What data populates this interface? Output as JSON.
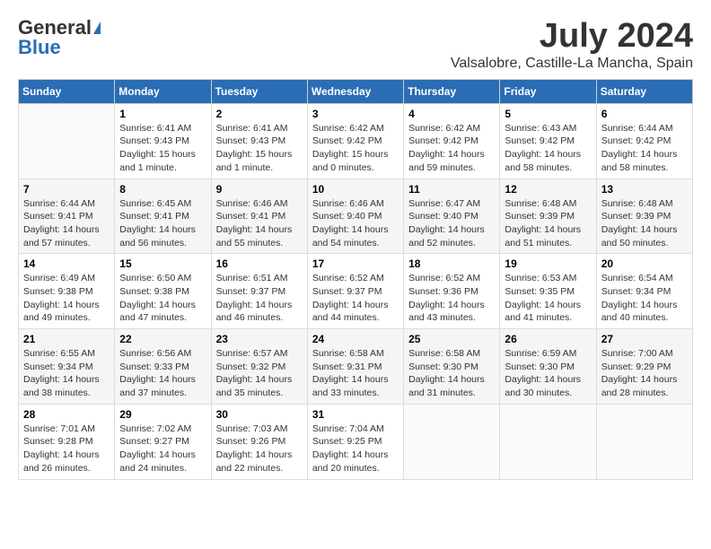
{
  "header": {
    "logo_general": "General",
    "logo_blue": "Blue",
    "month_title": "July 2024",
    "location": "Valsalobre, Castille-La Mancha, Spain"
  },
  "days_of_week": [
    "Sunday",
    "Monday",
    "Tuesday",
    "Wednesday",
    "Thursday",
    "Friday",
    "Saturday"
  ],
  "weeks": [
    [
      {
        "day": "",
        "sunrise": "",
        "sunset": "",
        "daylight": ""
      },
      {
        "day": "1",
        "sunrise": "Sunrise: 6:41 AM",
        "sunset": "Sunset: 9:43 PM",
        "daylight": "Daylight: 15 hours and 1 minute."
      },
      {
        "day": "2",
        "sunrise": "Sunrise: 6:41 AM",
        "sunset": "Sunset: 9:43 PM",
        "daylight": "Daylight: 15 hours and 1 minute."
      },
      {
        "day": "3",
        "sunrise": "Sunrise: 6:42 AM",
        "sunset": "Sunset: 9:42 PM",
        "daylight": "Daylight: 15 hours and 0 minutes."
      },
      {
        "day": "4",
        "sunrise": "Sunrise: 6:42 AM",
        "sunset": "Sunset: 9:42 PM",
        "daylight": "Daylight: 14 hours and 59 minutes."
      },
      {
        "day": "5",
        "sunrise": "Sunrise: 6:43 AM",
        "sunset": "Sunset: 9:42 PM",
        "daylight": "Daylight: 14 hours and 58 minutes."
      },
      {
        "day": "6",
        "sunrise": "Sunrise: 6:44 AM",
        "sunset": "Sunset: 9:42 PM",
        "daylight": "Daylight: 14 hours and 58 minutes."
      }
    ],
    [
      {
        "day": "7",
        "sunrise": "Sunrise: 6:44 AM",
        "sunset": "Sunset: 9:41 PM",
        "daylight": "Daylight: 14 hours and 57 minutes."
      },
      {
        "day": "8",
        "sunrise": "Sunrise: 6:45 AM",
        "sunset": "Sunset: 9:41 PM",
        "daylight": "Daylight: 14 hours and 56 minutes."
      },
      {
        "day": "9",
        "sunrise": "Sunrise: 6:46 AM",
        "sunset": "Sunset: 9:41 PM",
        "daylight": "Daylight: 14 hours and 55 minutes."
      },
      {
        "day": "10",
        "sunrise": "Sunrise: 6:46 AM",
        "sunset": "Sunset: 9:40 PM",
        "daylight": "Daylight: 14 hours and 54 minutes."
      },
      {
        "day": "11",
        "sunrise": "Sunrise: 6:47 AM",
        "sunset": "Sunset: 9:40 PM",
        "daylight": "Daylight: 14 hours and 52 minutes."
      },
      {
        "day": "12",
        "sunrise": "Sunrise: 6:48 AM",
        "sunset": "Sunset: 9:39 PM",
        "daylight": "Daylight: 14 hours and 51 minutes."
      },
      {
        "day": "13",
        "sunrise": "Sunrise: 6:48 AM",
        "sunset": "Sunset: 9:39 PM",
        "daylight": "Daylight: 14 hours and 50 minutes."
      }
    ],
    [
      {
        "day": "14",
        "sunrise": "Sunrise: 6:49 AM",
        "sunset": "Sunset: 9:38 PM",
        "daylight": "Daylight: 14 hours and 49 minutes."
      },
      {
        "day": "15",
        "sunrise": "Sunrise: 6:50 AM",
        "sunset": "Sunset: 9:38 PM",
        "daylight": "Daylight: 14 hours and 47 minutes."
      },
      {
        "day": "16",
        "sunrise": "Sunrise: 6:51 AM",
        "sunset": "Sunset: 9:37 PM",
        "daylight": "Daylight: 14 hours and 46 minutes."
      },
      {
        "day": "17",
        "sunrise": "Sunrise: 6:52 AM",
        "sunset": "Sunset: 9:37 PM",
        "daylight": "Daylight: 14 hours and 44 minutes."
      },
      {
        "day": "18",
        "sunrise": "Sunrise: 6:52 AM",
        "sunset": "Sunset: 9:36 PM",
        "daylight": "Daylight: 14 hours and 43 minutes."
      },
      {
        "day": "19",
        "sunrise": "Sunrise: 6:53 AM",
        "sunset": "Sunset: 9:35 PM",
        "daylight": "Daylight: 14 hours and 41 minutes."
      },
      {
        "day": "20",
        "sunrise": "Sunrise: 6:54 AM",
        "sunset": "Sunset: 9:34 PM",
        "daylight": "Daylight: 14 hours and 40 minutes."
      }
    ],
    [
      {
        "day": "21",
        "sunrise": "Sunrise: 6:55 AM",
        "sunset": "Sunset: 9:34 PM",
        "daylight": "Daylight: 14 hours and 38 minutes."
      },
      {
        "day": "22",
        "sunrise": "Sunrise: 6:56 AM",
        "sunset": "Sunset: 9:33 PM",
        "daylight": "Daylight: 14 hours and 37 minutes."
      },
      {
        "day": "23",
        "sunrise": "Sunrise: 6:57 AM",
        "sunset": "Sunset: 9:32 PM",
        "daylight": "Daylight: 14 hours and 35 minutes."
      },
      {
        "day": "24",
        "sunrise": "Sunrise: 6:58 AM",
        "sunset": "Sunset: 9:31 PM",
        "daylight": "Daylight: 14 hours and 33 minutes."
      },
      {
        "day": "25",
        "sunrise": "Sunrise: 6:58 AM",
        "sunset": "Sunset: 9:30 PM",
        "daylight": "Daylight: 14 hours and 31 minutes."
      },
      {
        "day": "26",
        "sunrise": "Sunrise: 6:59 AM",
        "sunset": "Sunset: 9:30 PM",
        "daylight": "Daylight: 14 hours and 30 minutes."
      },
      {
        "day": "27",
        "sunrise": "Sunrise: 7:00 AM",
        "sunset": "Sunset: 9:29 PM",
        "daylight": "Daylight: 14 hours and 28 minutes."
      }
    ],
    [
      {
        "day": "28",
        "sunrise": "Sunrise: 7:01 AM",
        "sunset": "Sunset: 9:28 PM",
        "daylight": "Daylight: 14 hours and 26 minutes."
      },
      {
        "day": "29",
        "sunrise": "Sunrise: 7:02 AM",
        "sunset": "Sunset: 9:27 PM",
        "daylight": "Daylight: 14 hours and 24 minutes."
      },
      {
        "day": "30",
        "sunrise": "Sunrise: 7:03 AM",
        "sunset": "Sunset: 9:26 PM",
        "daylight": "Daylight: 14 hours and 22 minutes."
      },
      {
        "day": "31",
        "sunrise": "Sunrise: 7:04 AM",
        "sunset": "Sunset: 9:25 PM",
        "daylight": "Daylight: 14 hours and 20 minutes."
      },
      {
        "day": "",
        "sunrise": "",
        "sunset": "",
        "daylight": ""
      },
      {
        "day": "",
        "sunrise": "",
        "sunset": "",
        "daylight": ""
      },
      {
        "day": "",
        "sunrise": "",
        "sunset": "",
        "daylight": ""
      }
    ]
  ]
}
